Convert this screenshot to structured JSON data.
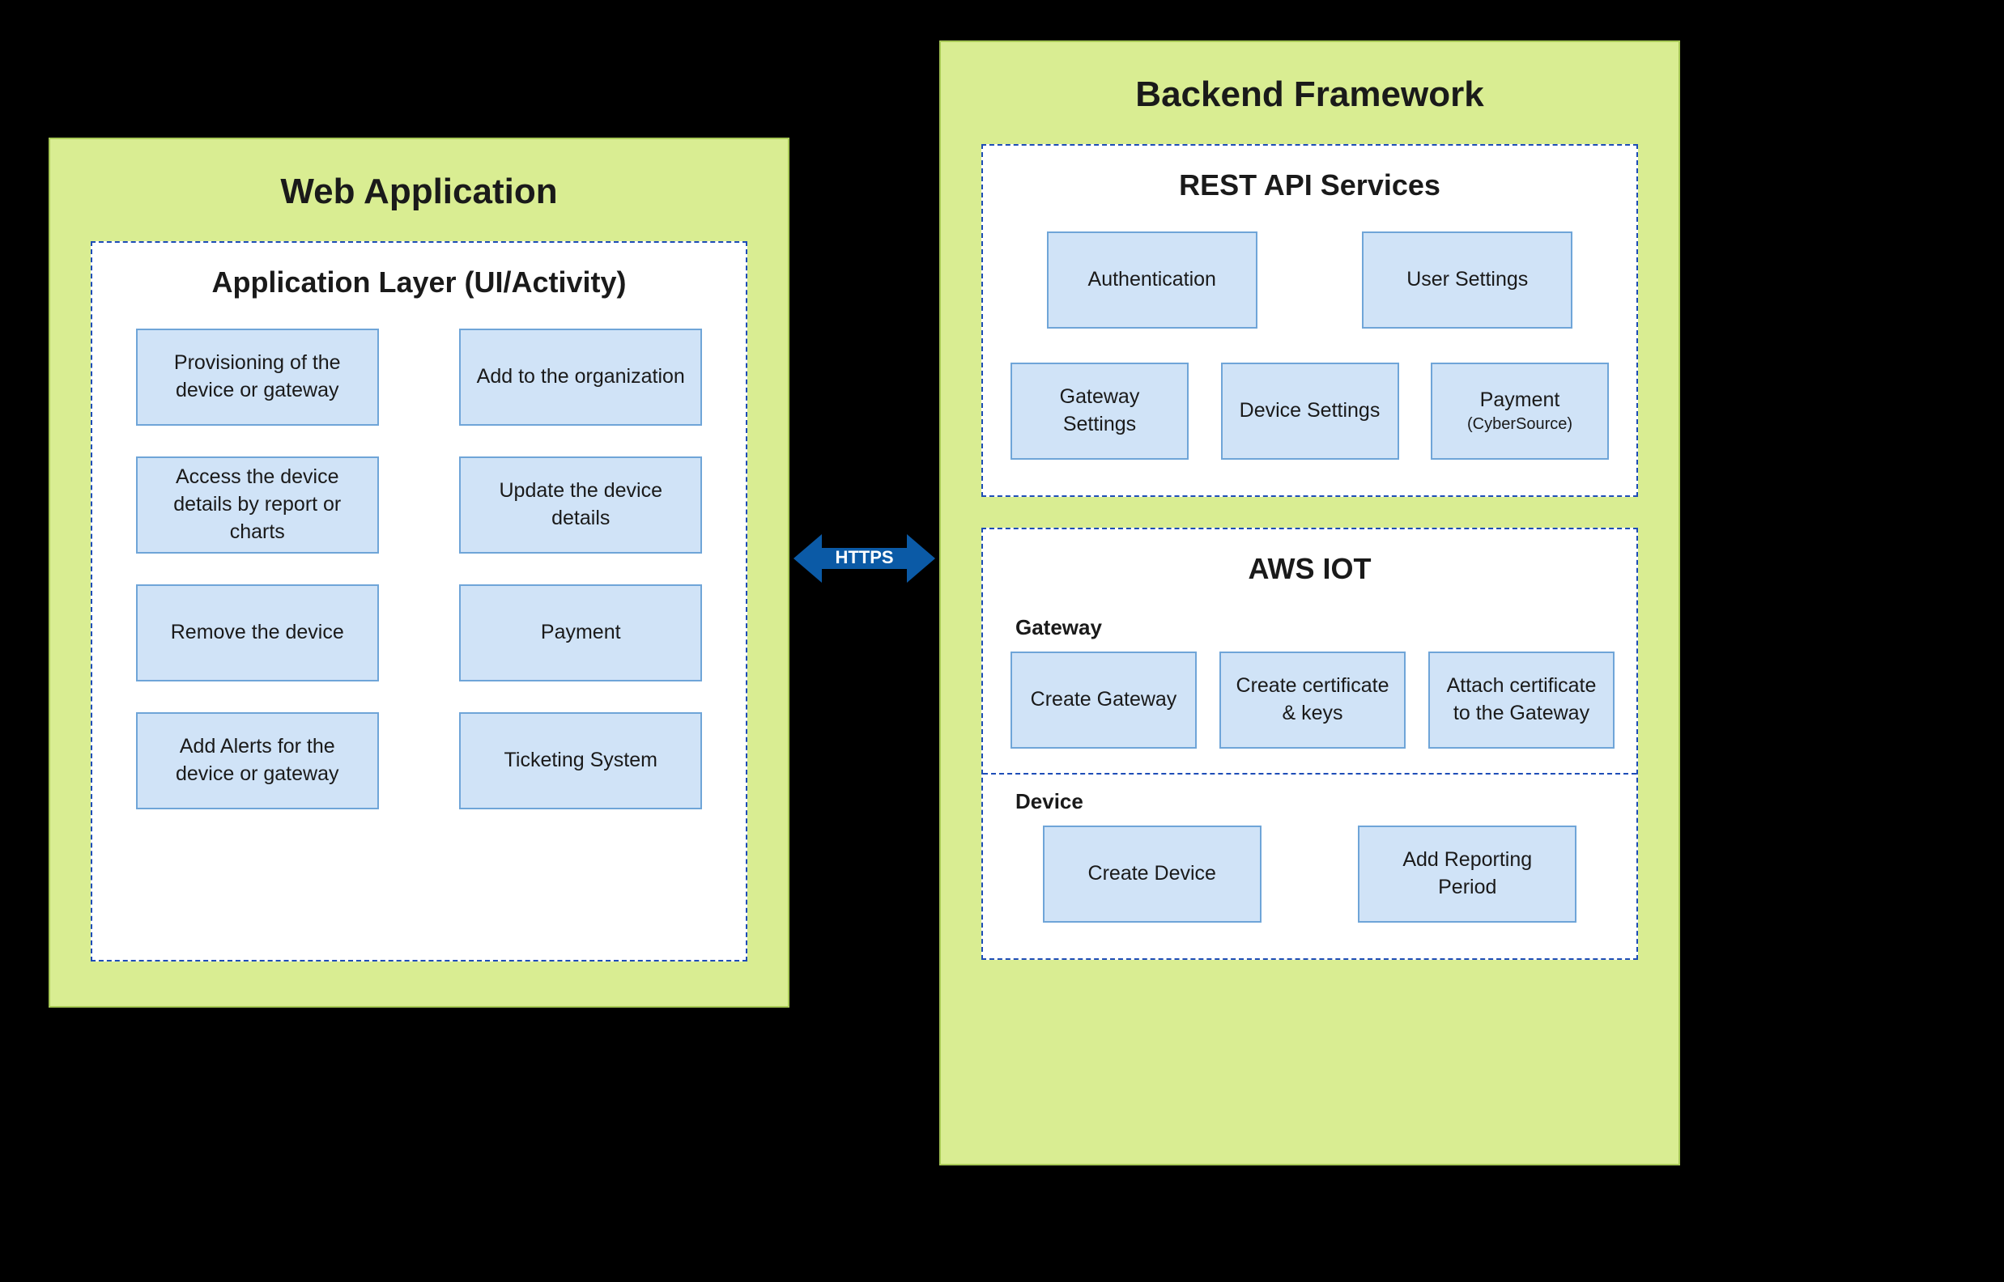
{
  "web": {
    "title": "Web Application",
    "layer_title": "Application Layer (UI/Activity)",
    "nodes": [
      "Provisioning of the device or gateway",
      "Add to the organization",
      "Access the device details by report or charts",
      "Update the device details",
      "Remove the device",
      "Payment",
      "Add Alerts for the device or gateway",
      "Ticketing System"
    ]
  },
  "connector": {
    "label": "HTTPS"
  },
  "backend": {
    "title": "Backend Framework",
    "api": {
      "title": "REST API Services",
      "row1": [
        "Authentication",
        "User Settings"
      ],
      "row2": [
        "Gateway Settings",
        "Device Settings"
      ],
      "payment_main": "Payment",
      "payment_sub": "(CyberSource)"
    },
    "iot": {
      "title": "AWS IOT",
      "gateway_label": "Gateway",
      "gateway_nodes": [
        "Create Gateway",
        "Create certificate & keys",
        "Attach certificate to the Gateway"
      ],
      "device_label": "Device",
      "device_nodes": [
        "Create Device",
        "Add Reporting Period"
      ]
    }
  }
}
